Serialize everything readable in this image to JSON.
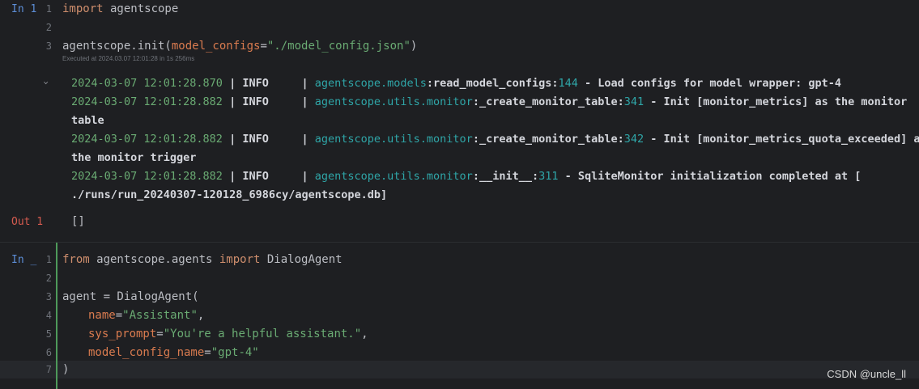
{
  "cell1": {
    "prompt": "In 1",
    "line_numbers": [
      "1",
      "2",
      "3"
    ],
    "line1_kw": "import",
    "line1_rest": " agentscope",
    "line3_pre": "agentscope.init(",
    "line3_param": "model_configs",
    "line3_eq": "=",
    "line3_str": "\"./model_config.json\"",
    "line3_post": ")",
    "exec_info": "Executed at 2024.03.07 12:01:28 in 1s 256ms"
  },
  "output1": {
    "chevron": "⌄",
    "logs": [
      {
        "ts": "2024-03-07 12:01:28.870",
        "level": " | INFO     | ",
        "module": "agentscope.models",
        "func": ":read_model_configs:",
        "line": "144",
        "msg": " - Load configs for model wrapper: gpt-4"
      },
      {
        "ts": "2024-03-07 12:01:28.882",
        "level": " | INFO     | ",
        "module": "agentscope.utils.monitor",
        "func": ":_create_monitor_table:",
        "line": "341",
        "msg": " - Init [monitor_metrics] as the monitor",
        "cont": "table"
      },
      {
        "ts": "2024-03-07 12:01:28.882",
        "level": " | INFO     | ",
        "module": "agentscope.utils.monitor",
        "func": ":_create_monitor_table:",
        "line": "342",
        "msg": " - Init [monitor_metrics_quota_exceeded] as",
        "cont": "the monitor trigger"
      },
      {
        "ts": "2024-03-07 12:01:28.882",
        "level": " | INFO     | ",
        "module": "agentscope.utils.monitor",
        "func": ":__init__:",
        "line": "311",
        "msg": " - SqliteMonitor initialization completed at [",
        "cont": "./runs/run_20240307-120128_6986cy/agentscope.db]"
      }
    ],
    "out_prompt": "Out 1",
    "out_value": "[]"
  },
  "cell2": {
    "prompt": "In _",
    "line_numbers": [
      "1",
      "2",
      "3",
      "4",
      "5",
      "6",
      "7"
    ],
    "l1_kw1": "from",
    "l1_mid": " agentscope.agents ",
    "l1_kw2": "import",
    "l1_rest": " DialogAgent",
    "l3": "agent = DialogAgent(",
    "l4_param": "name",
    "l4_str": "\"Assistant\"",
    "l5_param": "sys_prompt",
    "l5_str": "\"You're a helpful assistant.\"",
    "l6_param": "model_config_name",
    "l6_str": "\"gpt-4\"",
    "l7": ")",
    "eq": "=",
    "comma": ","
  },
  "watermark": "CSDN @uncle_ll",
  "colors": {
    "background": "#1e1f22",
    "keyword": "#cf8e6d",
    "string": "#6aab73",
    "module": "#2fa6a8",
    "prompt_in": "#5c8dd6",
    "prompt_out": "#d35a4f",
    "active_bar": "#4e9a5a"
  }
}
